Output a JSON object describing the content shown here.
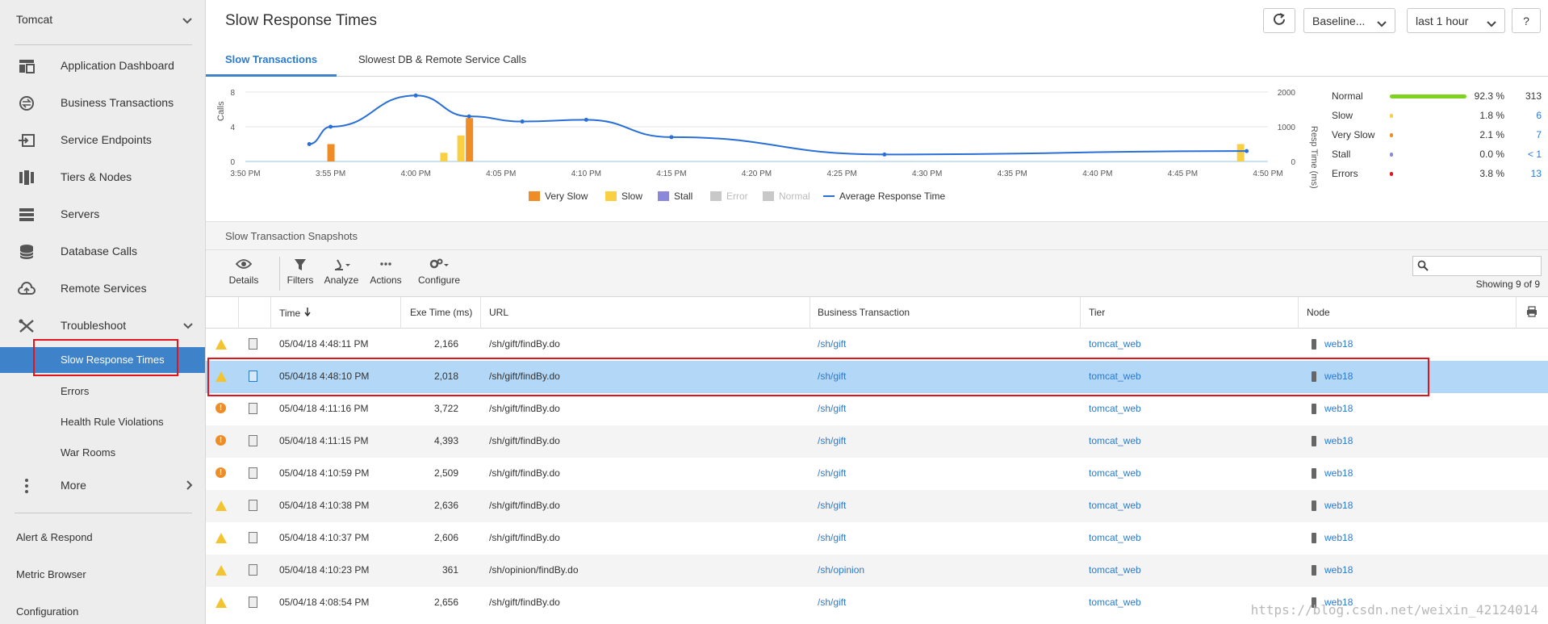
{
  "sidebar": {
    "app_name": "Tomcat",
    "nav": [
      {
        "label": "Application Dashboard",
        "icon": "dashboard-icon"
      },
      {
        "label": "Business Transactions",
        "icon": "transactions-icon"
      },
      {
        "label": "Service Endpoints",
        "icon": "service-endpoint-icon"
      },
      {
        "label": "Tiers & Nodes",
        "icon": "tiers-icon"
      },
      {
        "label": "Servers",
        "icon": "servers-icon"
      },
      {
        "label": "Database Calls",
        "icon": "database-icon"
      },
      {
        "label": "Remote Services",
        "icon": "cloud-icon"
      },
      {
        "label": "Troubleshoot",
        "icon": "tools-icon"
      }
    ],
    "troubleshoot_sub": [
      "Slow Response Times",
      "Errors",
      "Health Rule Violations",
      "War Rooms"
    ],
    "more_label": "More",
    "bottom": [
      "Alert & Respond",
      "Metric Browser",
      "Configuration"
    ]
  },
  "header": {
    "title": "Slow Response Times",
    "baseline": "Baseline...",
    "time_range": "last 1 hour",
    "help": "?"
  },
  "tabs": [
    "Slow Transactions",
    "Slowest DB & Remote Service Calls"
  ],
  "chart_data": {
    "type": "bar",
    "ylabel": "Calls",
    "ylabel_right": "Resp Time (ms)",
    "y_ticks": [
      "8",
      "4",
      "0"
    ],
    "y_right_ticks": [
      "2000",
      "1000",
      "0"
    ],
    "x_ticks": [
      "3:50 PM",
      "3:55 PM",
      "4:00 PM",
      "4:05 PM",
      "4:10 PM",
      "4:15 PM",
      "4:20 PM",
      "4:25 PM",
      "4:30 PM",
      "4:35 PM",
      "4:40 PM",
      "4:45 PM",
      "4:50 PM"
    ],
    "ylim": [
      0,
      8
    ],
    "y_right_lim": [
      0,
      2000
    ],
    "series": [
      {
        "name": "Very Slow",
        "color": "#f08c25",
        "values": [
          [
            4.0,
            2
          ],
          [
            10.5,
            5
          ]
        ]
      },
      {
        "name": "Slow",
        "color": "#f9cf44",
        "values": [
          [
            9.3,
            1
          ],
          [
            10.1,
            3
          ],
          [
            46.7,
            2
          ]
        ]
      },
      {
        "name": "Stall",
        "color": "#8c88d9",
        "values": []
      },
      {
        "name": "Error",
        "color": "#c8c8c8",
        "values": []
      },
      {
        "name": "Normal",
        "color": "#c8c8c8",
        "values": []
      },
      {
        "name": "Average Response Time",
        "color": "#2a6fd6",
        "values": [
          [
            3,
            500
          ],
          [
            4,
            1000
          ],
          [
            8,
            1900
          ],
          [
            10.5,
            1300
          ],
          [
            13,
            1150
          ],
          [
            16,
            1200
          ],
          [
            20,
            700
          ],
          [
            30,
            200
          ],
          [
            47,
            300
          ]
        ]
      }
    ],
    "legend": [
      {
        "label": "Very Slow",
        "color": "#f08c25",
        "muted": false
      },
      {
        "label": "Slow",
        "color": "#f9cf44",
        "muted": false
      },
      {
        "label": "Stall",
        "color": "#8c88d9",
        "muted": false
      },
      {
        "label": "Error",
        "color": "#c8c8c8",
        "muted": true
      },
      {
        "label": "Normal",
        "color": "#c8c8c8",
        "muted": true
      },
      {
        "label": "Average Response Time",
        "color": "#2a6fd6",
        "muted": false
      }
    ]
  },
  "stats": [
    {
      "name": "Normal",
      "pct": "92.3 %",
      "count": "313",
      "color": "#7ed321",
      "level": 0.923,
      "link": false
    },
    {
      "name": "Slow",
      "pct": "1.8 %",
      "count": "6",
      "color": "#f9cf44",
      "level": 0.018,
      "link": true
    },
    {
      "name": "Very Slow",
      "pct": "2.1 %",
      "count": "7",
      "color": "#f08c25",
      "level": 0.021,
      "link": true
    },
    {
      "name": "Stall",
      "pct": "0.0 %",
      "count": "< 1",
      "color": "#8c88d9",
      "level": 0.0,
      "link": true
    },
    {
      "name": "Errors",
      "pct": "3.8 %",
      "count": "13",
      "color": "#e0141a",
      "level": 0.038,
      "link": true
    }
  ],
  "snapshots": {
    "section_title": "Slow Transaction Snapshots",
    "tools": [
      {
        "label": "Details",
        "icon": "eye-icon",
        "glyph": "👁"
      },
      {
        "label": "Filters",
        "icon": "funnel-icon",
        "glyph": "▼"
      },
      {
        "label": "Analyze",
        "icon": "microscope-icon",
        "glyph": "⚗"
      },
      {
        "label": "Actions",
        "icon": "dots-icon",
        "glyph": "···"
      },
      {
        "label": "Configure",
        "icon": "gears-icon",
        "glyph": "⚙"
      }
    ],
    "showing": "Showing 9 of 9",
    "columns": [
      "Time",
      "Exe Time (ms)",
      "URL",
      "Business Transaction",
      "Tier",
      "Node"
    ],
    "rows": [
      {
        "sev": "warn",
        "time": "05/04/18 4:48:11 PM",
        "exe": "2,166",
        "url": "/sh/gift/findBy.do",
        "bt": "/sh/gift",
        "tier": "tomcat_web",
        "node": "web18"
      },
      {
        "sev": "warn",
        "time": "05/04/18 4:48:10 PM",
        "exe": "2,018",
        "url": "/sh/gift/findBy.do",
        "bt": "/sh/gift",
        "tier": "tomcat_web",
        "node": "web18"
      },
      {
        "sev": "crit",
        "time": "05/04/18 4:11:16 PM",
        "exe": "3,722",
        "url": "/sh/gift/findBy.do",
        "bt": "/sh/gift",
        "tier": "tomcat_web",
        "node": "web18"
      },
      {
        "sev": "crit",
        "time": "05/04/18 4:11:15 PM",
        "exe": "4,393",
        "url": "/sh/gift/findBy.do",
        "bt": "/sh/gift",
        "tier": "tomcat_web",
        "node": "web18"
      },
      {
        "sev": "crit",
        "time": "05/04/18 4:10:59 PM",
        "exe": "2,509",
        "url": "/sh/gift/findBy.do",
        "bt": "/sh/gift",
        "tier": "tomcat_web",
        "node": "web18"
      },
      {
        "sev": "warn",
        "time": "05/04/18 4:10:38 PM",
        "exe": "2,636",
        "url": "/sh/gift/findBy.do",
        "bt": "/sh/gift",
        "tier": "tomcat_web",
        "node": "web18"
      },
      {
        "sev": "warn",
        "time": "05/04/18 4:10:37 PM",
        "exe": "2,606",
        "url": "/sh/gift/findBy.do",
        "bt": "/sh/gift",
        "tier": "tomcat_web",
        "node": "web18"
      },
      {
        "sev": "warn",
        "time": "05/04/18 4:10:23 PM",
        "exe": "361",
        "url": "/sh/opinion/findBy.do",
        "bt": "/sh/opinion",
        "tier": "tomcat_web",
        "node": "web18"
      },
      {
        "sev": "warn",
        "time": "05/04/18 4:08:54 PM",
        "exe": "2,656",
        "url": "/sh/gift/findBy.do",
        "bt": "/sh/gift",
        "tier": "tomcat_web",
        "node": "web18"
      }
    ]
  },
  "watermark": "https://blog.csdn.net/weixin_42124014"
}
